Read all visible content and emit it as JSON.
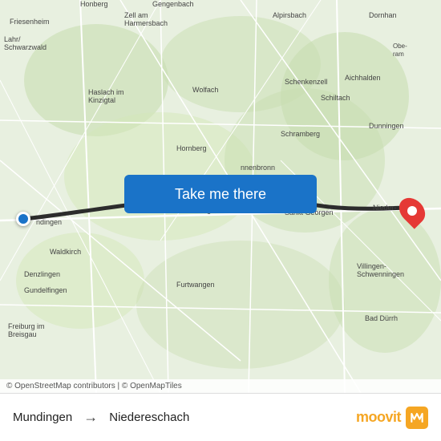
{
  "map": {
    "attribution": "© OpenStreetMap contributors | © OpenMapTiles",
    "center_lat": 48.15,
    "center_lng": 8.2
  },
  "button": {
    "label": "Take me there"
  },
  "bottom_bar": {
    "origin": "Mundingen",
    "arrow": "→",
    "destination": "Niedereschach"
  },
  "branding": {
    "name": "moovit"
  },
  "places": [
    "Friesenheim",
    "Lahr/Schwarzwald",
    "Zell am Harmersbach",
    "Alpirsbach",
    "Dornhan",
    "Haslach im Kinzigtal",
    "Wolfach",
    "Schenkenzell",
    "Schiltach",
    "Hornberg",
    "Schramberg",
    "Dunningen",
    "Triberg",
    "Sankt Georgen",
    "Niedereschach",
    "Mundingen",
    "Waldkirch",
    "Furtwangen",
    "Denzlingen",
    "Gundelfingen",
    "Freiburg im Breisgau",
    "Villingen-Schwenningen",
    "Bad Dürrh",
    "Honberg",
    "Gengenbach",
    "Obere am",
    "Aichhalden",
    "Haslach im Kinzigtal"
  ]
}
